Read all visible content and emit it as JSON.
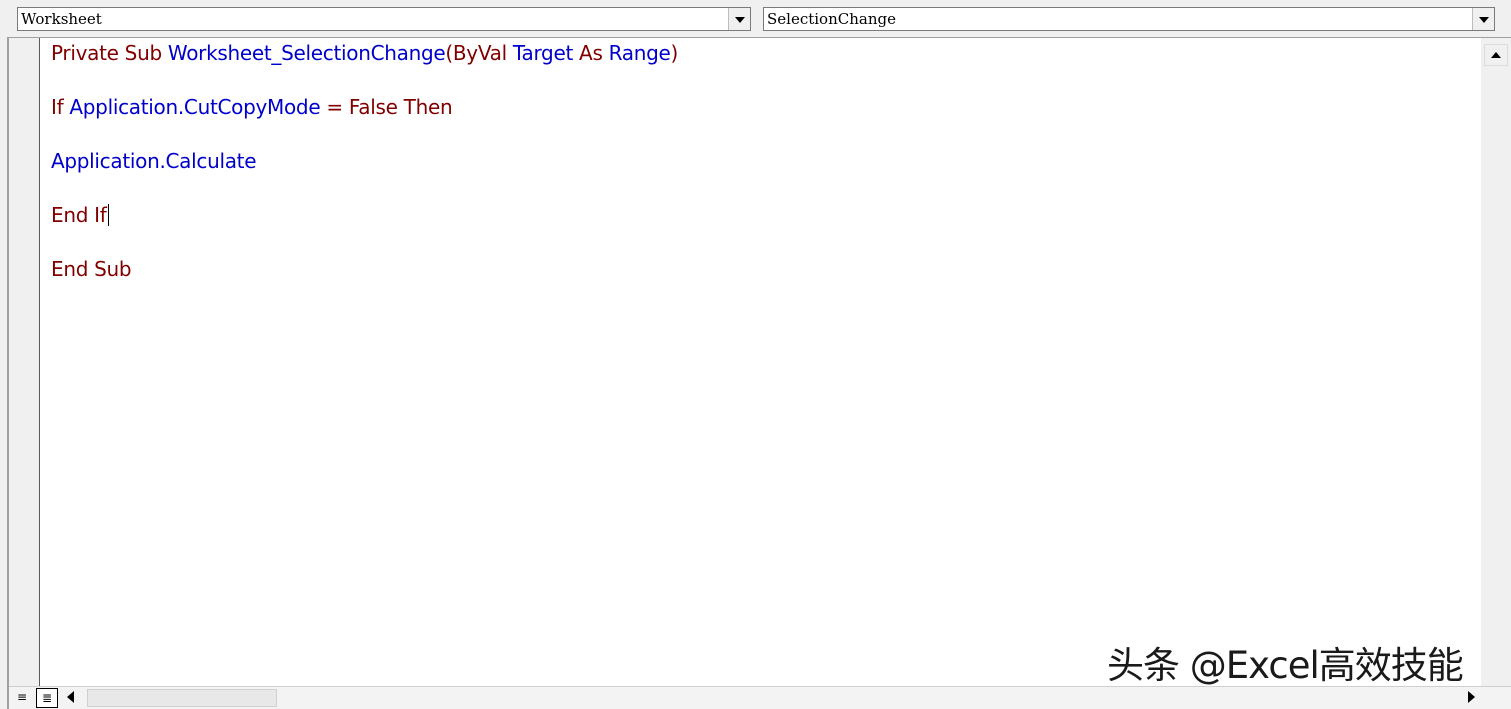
{
  "header": {
    "object_combo": "Worksheet",
    "procedure_combo": "SelectionChange"
  },
  "code": {
    "line1": {
      "t1": "Private Sub ",
      "t2": "Worksheet_SelectionChange",
      "t3": "(ByVal ",
      "t4": "Target",
      "t5": " As ",
      "t6": "Range",
      "t7": ")"
    },
    "line2": {
      "t1": "If ",
      "t2": "Application.CutCopyMode",
      "t3": " = ",
      "t4": "False Then"
    },
    "line3": {
      "t1": "Application.Calculate"
    },
    "line4": {
      "t1": "End If"
    },
    "line5": {
      "t1": "End Sub"
    }
  },
  "footer": {
    "procedure_view_glyph": "≡",
    "full_module_view_glyph": "≣"
  },
  "watermark": "头条 @Excel高效技能",
  "icons": {
    "dropdown": "chevron-down-icon",
    "scroll_up": "arrow-up-icon",
    "scroll_left": "arrow-left-icon",
    "scroll_right": "arrow-right-icon"
  },
  "colors": {
    "keyword": "#800000",
    "identifier": "#0000cc"
  }
}
